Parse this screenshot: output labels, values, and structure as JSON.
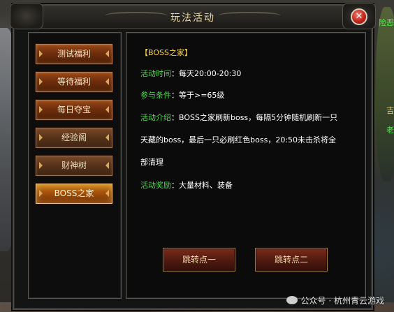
{
  "window": {
    "title": "玩法活动",
    "close_label": "✕"
  },
  "menu": {
    "items": [
      {
        "label": "测试福利",
        "state": "active"
      },
      {
        "label": "等待福利",
        "state": "active"
      },
      {
        "label": "每日夺宝",
        "state": "active"
      },
      {
        "label": "经验阁",
        "state": "normal"
      },
      {
        "label": "财神树",
        "state": "normal"
      },
      {
        "label": "BOSS之家",
        "state": "selected"
      }
    ]
  },
  "content": {
    "heading": "【BOSS之家】",
    "time_label": "活动时间",
    "time_sep": "：",
    "time_value": "每天20:00-20:30",
    "cond_label": "参与条件",
    "cond_sep": "：",
    "cond_value": "等于>=65级",
    "intro_label": "活动介绍",
    "intro_sep": "：",
    "intro_line1": "BOSS之家刷新boss，每隔5分钟随机刷新一只",
    "intro_line2": "天藏的boss，最后一只必刷红色boss，20:50未击杀将全",
    "intro_line3": "部清理",
    "reward_label": "活动奖励",
    "reward_sep": "：",
    "reward_value": "大量材料、装备"
  },
  "buttons": {
    "jump1": "跳转点一",
    "jump2": "跳转点二"
  },
  "watermark": "公众号 · 杭州青云游戏",
  "map_labels": {
    "top_right": "险恶",
    "mid_right": "老",
    "right_yellow": "吉"
  },
  "colors": {
    "label_green": "#4cd84a",
    "heading_yellow": "#ffd54a",
    "close_red": "#c2261c"
  }
}
